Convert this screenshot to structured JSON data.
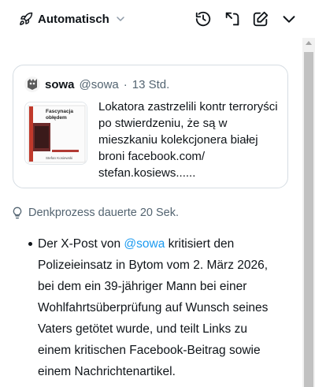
{
  "header": {
    "mode_label": "Automatisch",
    "icons": [
      "rocket-icon",
      "chevron-down-icon",
      "history-icon",
      "expand-icon",
      "edit-icon",
      "collapse-chevron-icon"
    ]
  },
  "quoted_post": {
    "name": "sowa",
    "handle": "@sowa",
    "separator": "·",
    "time": "13 Std.",
    "text": "Lokatora zastrzelili kontr terroryści po stwierdzeniu, że są w mieszkaniu kolekcjonera białej broni facebook.com/ stefan.kosiews......",
    "thumbnail": {
      "title_line1": "Fascynacja",
      "title_line2": "obłędem",
      "author": "Stefan Kosiewski"
    }
  },
  "thinking": {
    "label": "Denkprozess dauerte 20 Sek."
  },
  "answer": {
    "prefix": "Der X-Post von ",
    "mention": "@sowa",
    "suffix": " kritisiert den Polizeieinsatz in Bytom vom 2. März 2026, bei dem ein 39-jähriger Mann bei einer Wohlfahrtsüberprüfung auf Wunsch seines Vaters getötet wurde, und teilt Links zu einem kritischen Facebook-Beitrag sowie einem Nachrichtenartikel."
  },
  "colors": {
    "text": "#0f1419",
    "muted": "#536471",
    "link": "#1d9bf0",
    "border": "#d6dde3"
  }
}
